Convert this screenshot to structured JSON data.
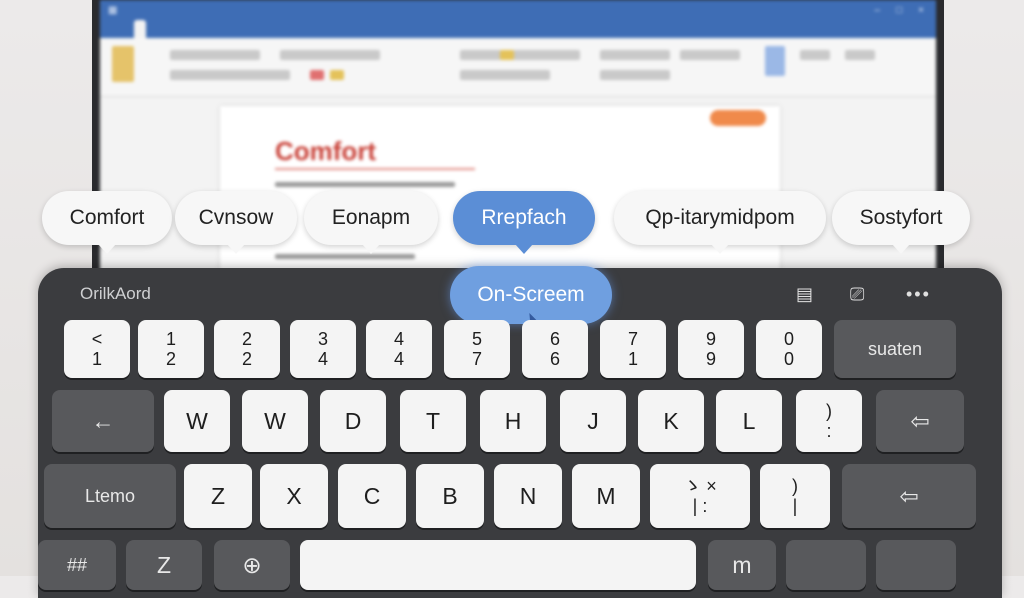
{
  "background_doc": {
    "heading": "Comfort"
  },
  "suggestions": [
    "Comfort",
    "Cvnsow",
    "Eonapm",
    "Rrepfach",
    "Qp-itarymidpom",
    "Sostyfort"
  ],
  "keyboard": {
    "title": "OrilkAord",
    "mode_badge": "On-Screem",
    "toolbar_icons": [
      "clipboard-icon",
      "screen-icon",
      "more-icon"
    ],
    "row1": [
      {
        "top": "<",
        "bottom": "1"
      },
      {
        "top": "1",
        "bottom": "2"
      },
      {
        "top": "2",
        "bottom": "2"
      },
      {
        "top": "3",
        "bottom": "4"
      },
      {
        "top": "4",
        "bottom": "4"
      },
      {
        "top": "5",
        "bottom": "7"
      },
      {
        "top": "6",
        "bottom": "6"
      },
      {
        "top": "7",
        "bottom": "1"
      },
      {
        "top": "9",
        "bottom": "9"
      },
      {
        "top": "0",
        "bottom": "0"
      }
    ],
    "row1_end": "suaten",
    "row2_start": "←",
    "row2": [
      "W",
      "W",
      "D",
      "T",
      "H",
      "J",
      "K",
      "L"
    ],
    "row2_punct": {
      "top": ")",
      "bottom": ":"
    },
    "row2_end": "⇦",
    "row3_start": "Ltemo",
    "row3": [
      "Z",
      "X",
      "C",
      "B",
      "N",
      "M"
    ],
    "row3_punct1": {
      "top": "ゝ ×",
      "bottom": "| :"
    },
    "row3_punct2": {
      "top": ")",
      "bottom": "|"
    },
    "row3_end": "⇦",
    "row4": [
      "##",
      "Z",
      "⊕",
      "",
      "m"
    ]
  },
  "colors": {
    "accent": "#5b8ed6",
    "keyboard_bg": "#3b3c3f",
    "key_bg": "#f4f4f4",
    "heading_red": "#c9433a"
  }
}
